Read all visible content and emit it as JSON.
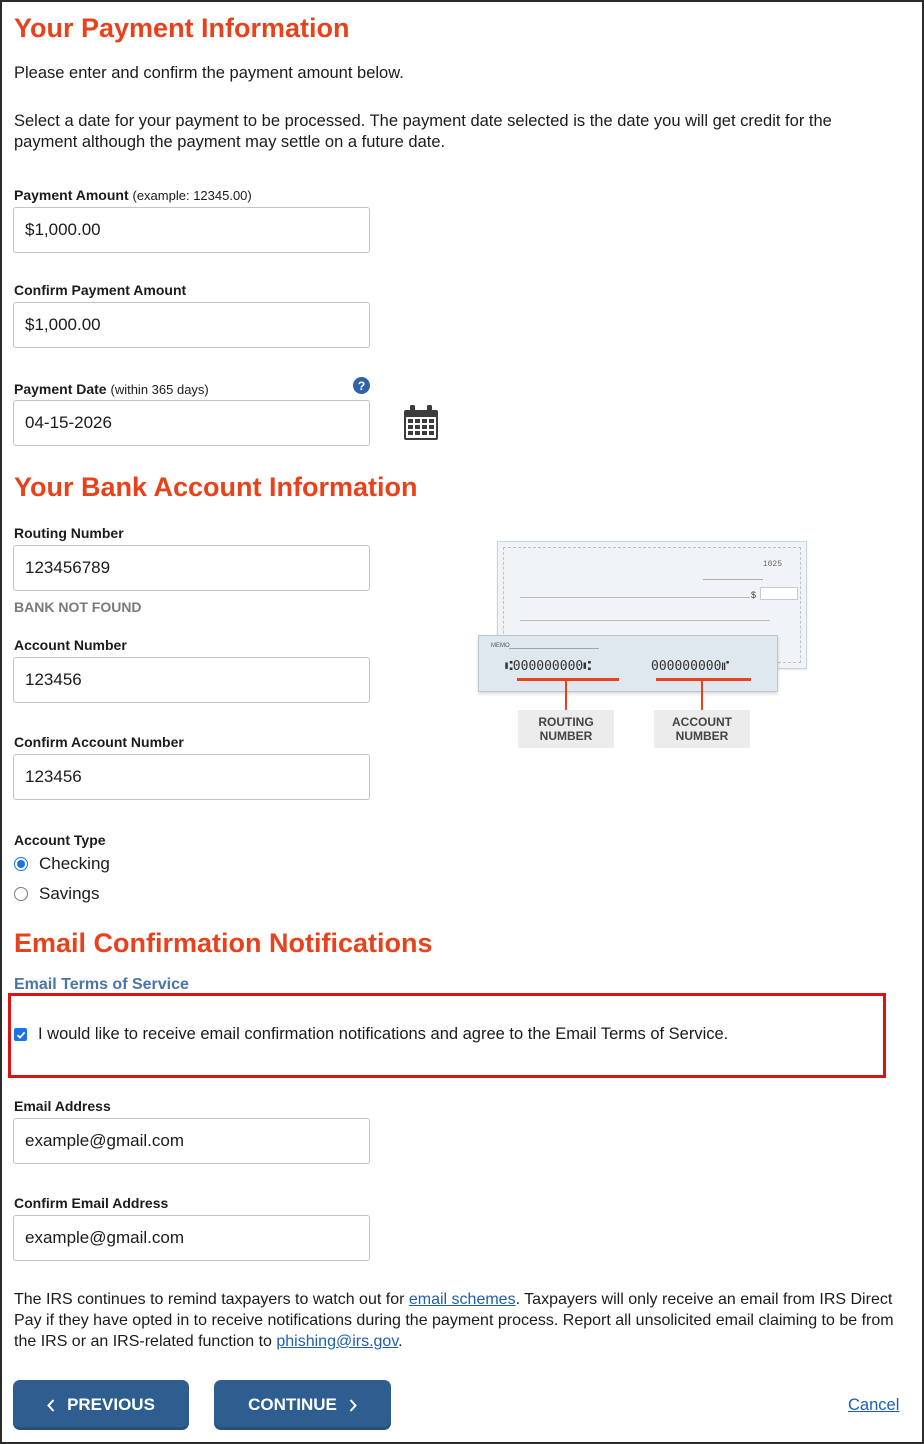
{
  "payment": {
    "heading": "Your Payment Information",
    "intro": "Please enter and confirm the payment amount below.",
    "date_note": "Select a date for your payment to be processed. The payment date selected is the date you will get credit for the payment although the payment may settle on a future date.",
    "amount_label": "Payment Amount",
    "amount_hint": "(example: 12345.00)",
    "amount_value": "$1,000.00",
    "confirm_amount_label": "Confirm Payment Amount",
    "confirm_amount_value": "$1,000.00",
    "date_label": "Payment Date",
    "date_hint": "(within 365 days)",
    "date_value": "04-15-2026",
    "help_glyph": "?",
    "help_icon": "question-circle-icon",
    "calendar_icon": "calendar-icon"
  },
  "bank": {
    "heading": "Your Bank Account Information",
    "routing_label": "Routing Number",
    "routing_value": "123456789",
    "routing_status": "BANK NOT FOUND",
    "account_label": "Account Number",
    "account_value": "123456",
    "confirm_account_label": "Confirm Account Number",
    "confirm_account_value": "123456",
    "account_type_label": "Account Type",
    "account_types": [
      "Checking",
      "Savings"
    ],
    "selected_account_type": "Checking",
    "check_image": {
      "check_number": "1025",
      "memo_text": "MEMO",
      "dollar_sign": "$",
      "routing_digits": "⑆000000000⑆",
      "account_digits": "000000000⑈",
      "routing_caption": "ROUTING NUMBER",
      "account_caption": "ACCOUNT NUMBER"
    }
  },
  "email": {
    "heading": "Email Confirmation Notifications",
    "tos_link": "Email Terms of Service",
    "consent_text": "I would like to receive email confirmation notifications and agree to the Email Terms of Service.",
    "consent_checked": true,
    "address_label": "Email Address",
    "address_value": "example@gmail.com",
    "confirm_address_label": "Confirm Email Address",
    "confirm_address_value": "example@gmail.com"
  },
  "notice": {
    "part1": "The IRS continues to remind taxpayers to watch out for ",
    "link1": "email schemes",
    "part2": ". Taxpayers will only receive an email from IRS Direct Pay if they have opted in to receive notifications during the payment process. Report all unsolicited email claiming to be from the IRS or an IRS-related function to ",
    "link2": "phishing@irs.gov",
    "part3": "."
  },
  "actions": {
    "previous_label": "PREVIOUS",
    "continue_label": "CONTINUE",
    "cancel_label": "Cancel",
    "previous_icon": "chevron-left-icon",
    "continue_icon": "chevron-right-icon"
  },
  "colors": {
    "heading": "#e8421c",
    "button": "#2e5d8f",
    "link": "#1a5fb4",
    "highlight_border": "#d81414",
    "checkbox": "#1a73e8"
  }
}
